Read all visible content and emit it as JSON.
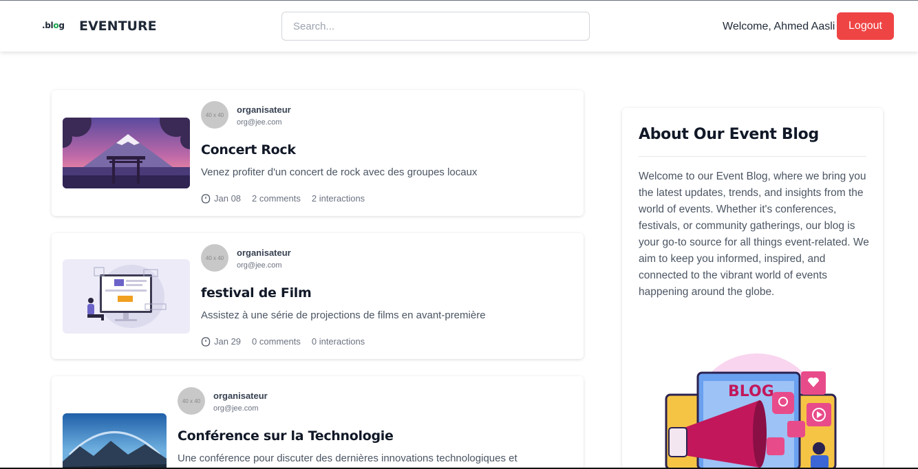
{
  "header": {
    "logo_text_prefix": ".bl",
    "logo_text_o": "o",
    "logo_text_suffix": "g",
    "brand": "EVENTURE",
    "search_placeholder": "Search...",
    "welcome": "Welcome, Ahmed Aasli",
    "logout_label": "Logout"
  },
  "posts": [
    {
      "avatar_placeholder": "40 x 40",
      "author_name": "organisateur",
      "author_email": "org@jee.com",
      "title": "Concert Rock",
      "description": "Venez profiter d'un concert de rock avec des groupes locaux",
      "date": "Jan 08",
      "comments": "2 comments",
      "interactions": "2 interactions"
    },
    {
      "avatar_placeholder": "40 x 40",
      "author_name": "organisateur",
      "author_email": "org@jee.com",
      "title": "festival de Film",
      "description": "Assistez à une série de projections de films en avant-première",
      "date": "Jan 29",
      "comments": "0 comments",
      "interactions": "0 interactions"
    },
    {
      "avatar_placeholder": "40 x 40",
      "author_name": "organisateur",
      "author_email": "org@jee.com",
      "title": "Conférence sur la Technologie",
      "description": "Une conférence pour discuter des dernières innovations technologiques et"
    }
  ],
  "sidebar": {
    "title": "About Our Event Blog",
    "text": "Welcome to our Event Blog, where we bring you the latest updates, trends, and insights from the world of events. Whether it's conferences, festivals, or community gatherings, our blog is your go-to source for all things event-related. We aim to keep you informed, inspired, and connected to the vibrant world of events happening around the globe.",
    "illustration_text": "BLOG"
  },
  "colors": {
    "logout": "#ef4444",
    "logo_accent": "#16a34a"
  }
}
